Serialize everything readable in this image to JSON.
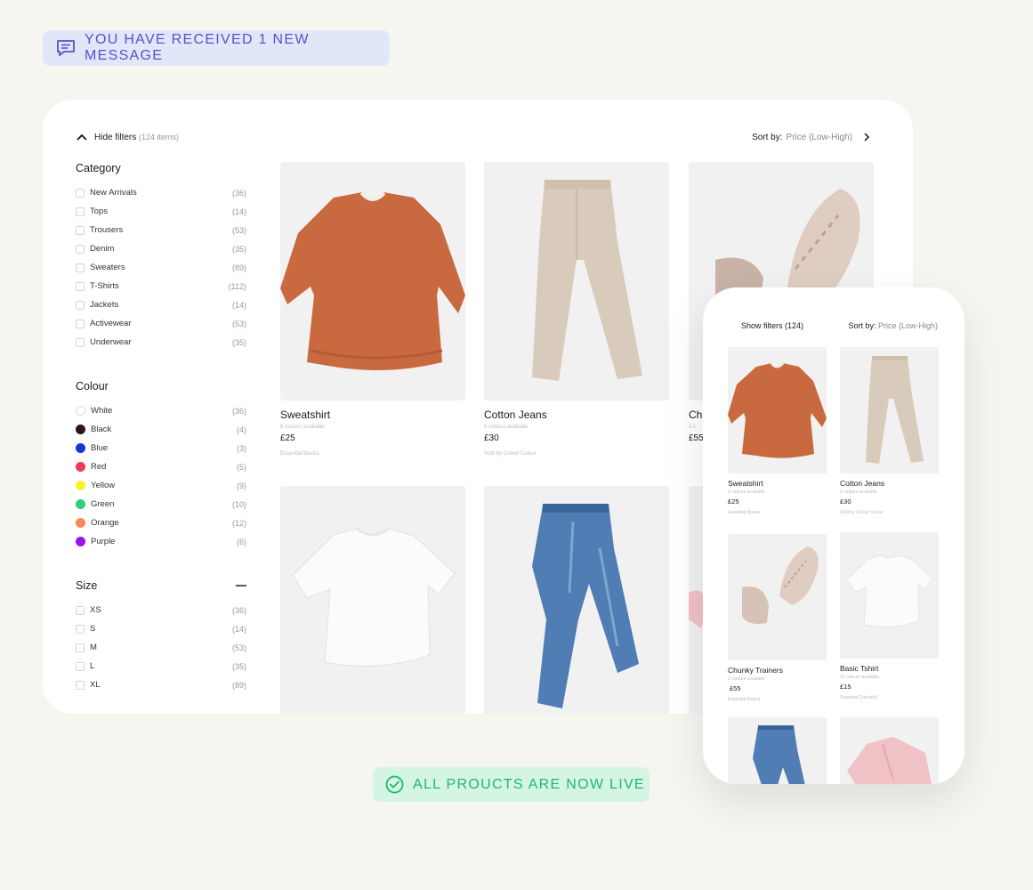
{
  "notification": {
    "text": "YOU HAVE RECEIVED 1 NEW MESSAGE",
    "icon": "message-icon"
  },
  "live_banner": {
    "text": "ALL PROUCTS ARE NOW LIVE",
    "icon": "check-circle-icon"
  },
  "desktop": {
    "hide_filters_label": "Hide filters",
    "items_count": "(124 items)",
    "sort_label": "Sort by:",
    "sort_value": "Price (Low-High)",
    "category": {
      "title": "Category",
      "items": [
        {
          "label": "New Arrivals",
          "count": "(36)"
        },
        {
          "label": "Tops",
          "count": "(14)"
        },
        {
          "label": "Trousers",
          "count": "(53)"
        },
        {
          "label": "Denim",
          "count": "(35)"
        },
        {
          "label": "Sweaters",
          "count": "(89)"
        },
        {
          "label": "T-Shirts",
          "count": "(112)"
        },
        {
          "label": "Jackets",
          "count": "(14)"
        },
        {
          "label": "Activewear",
          "count": "(53)"
        },
        {
          "label": "Underwear",
          "count": "(35)"
        }
      ]
    },
    "colour": {
      "title": "Colour",
      "items": [
        {
          "label": "White",
          "count": "(36)",
          "color": "#ffffff"
        },
        {
          "label": "Black",
          "count": "(4)",
          "color": "#2a1810"
        },
        {
          "label": "Blue",
          "count": "(3)",
          "color": "#1637d4"
        },
        {
          "label": "Red",
          "count": "(5)",
          "color": "#ef3a5d"
        },
        {
          "label": "Yellow",
          "count": "(9)",
          "color": "#f7f22a"
        },
        {
          "label": "Green",
          "count": "(10)",
          "color": "#2bcf7e"
        },
        {
          "label": "Orange",
          "count": "(12)",
          "color": "#f78a5a"
        },
        {
          "label": "Purple",
          "count": "(6)",
          "color": "#9a13e8"
        }
      ]
    },
    "size": {
      "title": "Size",
      "collapse_icon": "minus-icon",
      "items": [
        {
          "label": "XS",
          "count": "(36)"
        },
        {
          "label": "S",
          "count": "(14)"
        },
        {
          "label": "M",
          "count": "(53)"
        },
        {
          "label": "L",
          "count": "(35)"
        },
        {
          "label": "XL",
          "count": "(89)"
        }
      ]
    },
    "products": [
      {
        "name": "Sweatshirt",
        "colours": "6 colours available",
        "price": "£25",
        "seller": "Essential Basics",
        "image": "sweatshirt"
      },
      {
        "name": "Cotton Jeans",
        "colours": "5 colours available",
        "price": "£30",
        "seller": "Sold by Colour Colour",
        "image": "jeans-beige"
      },
      {
        "name": "Ch",
        "colours": "2 c",
        "price": "£55",
        "seller": "",
        "image": "trainers"
      }
    ],
    "products_row2": [
      {
        "image": "tshirt"
      },
      {
        "image": "jeans-blue"
      },
      {
        "image": "pink-partial"
      }
    ]
  },
  "mobile": {
    "show_filters_label": "Show filters (124)",
    "sort_label": "Sort by:",
    "sort_value": "Price (Low-High)",
    "products": [
      {
        "name": "Sweatshirt",
        "colours": "6 colours available",
        "price": "£25",
        "seller": "Essential Basics",
        "image": "sweatshirt"
      },
      {
        "name": "Cotton Jeans",
        "colours": "5 colours available",
        "price": "£30",
        "seller": "Sold by Colour Colour",
        "image": "jeans-beige"
      },
      {
        "name": "Chunky Trainers",
        "colours": "2 colours available",
        "price": "£55",
        "seller": "Essential Basics",
        "image": "trainers"
      },
      {
        "name": "Basic Tshirt",
        "colours": "20 colours available",
        "price": "£15",
        "seller": "Standard Colourful",
        "image": "tshirt"
      },
      {
        "image": "jeans-blue"
      },
      {
        "image": "pink-jacket"
      }
    ]
  }
}
